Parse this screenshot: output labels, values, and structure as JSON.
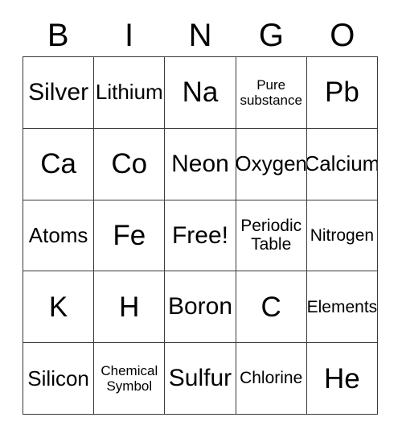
{
  "header": {
    "letters": [
      "B",
      "I",
      "N",
      "G",
      "O"
    ]
  },
  "grid": {
    "columns": 5,
    "rows": 5,
    "border_color": "#3a3a3a",
    "background_color": "#ffffff",
    "text_color": "#000000",
    "cells": [
      {
        "text": "Silver",
        "size": "lg"
      },
      {
        "text": "Lithium",
        "size": "md"
      },
      {
        "text": "Na",
        "size": "xl"
      },
      {
        "text": "Pure\nsubstance",
        "size": "xs"
      },
      {
        "text": "Pb",
        "size": "xl"
      },
      {
        "text": "Ca",
        "size": "xl"
      },
      {
        "text": "Co",
        "size": "xl"
      },
      {
        "text": "Neon",
        "size": "lg"
      },
      {
        "text": "Oxygen",
        "size": "md"
      },
      {
        "text": "Calcium",
        "size": "md"
      },
      {
        "text": "Atoms",
        "size": "md"
      },
      {
        "text": "Fe",
        "size": "xl"
      },
      {
        "text": "Free!",
        "size": "lg"
      },
      {
        "text": "Periodic\nTable",
        "size": "sm"
      },
      {
        "text": "Nitrogen",
        "size": "sm"
      },
      {
        "text": "K",
        "size": "xl"
      },
      {
        "text": "H",
        "size": "xl"
      },
      {
        "text": "Boron",
        "size": "lg"
      },
      {
        "text": "C",
        "size": "xl"
      },
      {
        "text": "Elements",
        "size": "sm"
      },
      {
        "text": "Silicon",
        "size": "md"
      },
      {
        "text": "Chemical\nSymbol",
        "size": "xs"
      },
      {
        "text": "Sulfur",
        "size": "lg"
      },
      {
        "text": "Chlorine",
        "size": "sm"
      },
      {
        "text": "He",
        "size": "xl"
      }
    ]
  }
}
